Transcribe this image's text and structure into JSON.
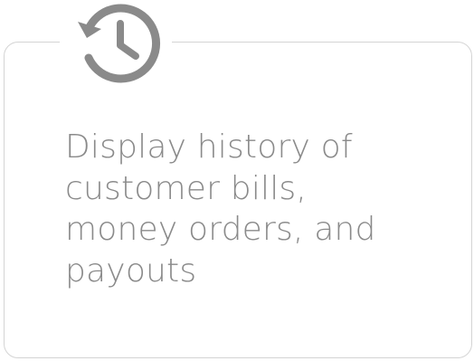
{
  "card": {
    "icon": "history-icon",
    "description": "Display history of customer bills, money orders, and payouts"
  },
  "colors": {
    "icon": "#8a8a8a",
    "text": "#8a8a8a",
    "border": "#d4d4d4"
  }
}
